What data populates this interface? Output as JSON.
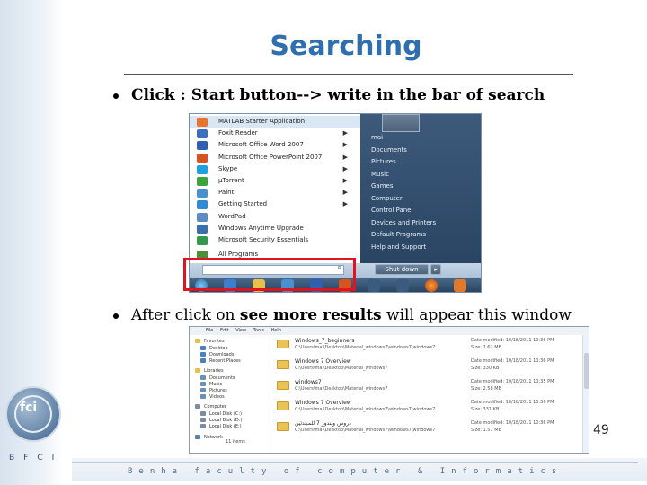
{
  "slide": {
    "title": "Searching",
    "bullet1": "Click : Start button--> write in the bar of search",
    "bullet2_before": "After click on ",
    "bullet2_bold": "see more results",
    "bullet2_after": " will appear this window",
    "page_number": "49",
    "footer": "Benha faculty of computer & Informatics",
    "logo_text": "BFCI",
    "logo_mark": "fci"
  },
  "start_menu": {
    "items": [
      {
        "label": "MATLAB Starter Application",
        "color": "#e8752a",
        "arrow": false
      },
      {
        "label": "Foxit Reader",
        "color": "#3b6fc0",
        "arrow": true
      },
      {
        "label": "Microsoft Office Word 2007",
        "color": "#2f5fb3",
        "arrow": true
      },
      {
        "label": "Microsoft Office PowerPoint 2007",
        "color": "#d9531e",
        "arrow": true
      },
      {
        "label": "Skype",
        "color": "#1aa3e0",
        "arrow": true
      },
      {
        "label": "µTorrent",
        "color": "#3aa53a",
        "arrow": true
      },
      {
        "label": "Paint",
        "color": "#4a8fd0",
        "arrow": true
      },
      {
        "label": "Getting Started",
        "color": "#2e8bd6",
        "arrow": true
      },
      {
        "label": "WordPad",
        "color": "#5b8dc4",
        "arrow": false
      },
      {
        "label": "Windows Anytime Upgrade",
        "color": "#3a6fb0",
        "arrow": false
      },
      {
        "label": "Microsoft Security Essentials",
        "color": "#2e9a4a",
        "arrow": false
      },
      {
        "label": "All Programs",
        "color": "#4b8f3a",
        "arrow": false
      }
    ],
    "right_items": [
      "mai",
      "Documents",
      "Pictures",
      "Music",
      "Games",
      "Computer",
      "Control Panel",
      "Devices and Printers",
      "Default Programs",
      "Help and Support"
    ],
    "shutdown_label": "Shut down",
    "shutdown_arrow": "▸",
    "search_icon": "magnifier-icon"
  },
  "explorer": {
    "menu": "File Edit View Tools Help",
    "sidebar": [
      {
        "label": "Favorites",
        "color": "#e8c14a"
      },
      {
        "label": "Desktop",
        "color": "#4a7fc0"
      },
      {
        "label": "Downloads",
        "color": "#4a7fc0"
      },
      {
        "label": "Recent Places",
        "color": "#4a7fc0"
      },
      {
        "label": "Libraries",
        "color": "#e8c14a"
      },
      {
        "label": "Documents",
        "color": "#6a8fb8"
      },
      {
        "label": "Music",
        "color": "#6a8fb8"
      },
      {
        "label": "Pictures",
        "color": "#6a8fb8"
      },
      {
        "label": "Videos",
        "color": "#6a8fb8"
      },
      {
        "label": "Computer",
        "color": "#7b8da3"
      },
      {
        "label": "Local Disk (C:)",
        "color": "#7b8da3"
      },
      {
        "label": "Local Disk (D:)",
        "color": "#7b8da3"
      },
      {
        "label": "Local Disk (E:)",
        "color": "#7b8da3"
      },
      {
        "label": "Network",
        "color": "#5b7fa8"
      }
    ],
    "rows": [
      {
        "name": "Windows_7_beginners",
        "path": "C:\\Users\\mai\\Desktop\\Material_windows7\\windows7\\windows7",
        "date": "Date modified: 10/18/2011 10:36 PM",
        "size": "Size: 2.62 MB"
      },
      {
        "name": "Windows 7 Overview",
        "path": "C:\\Users\\mai\\Desktop\\Material_windows7",
        "date": "Date modified: 10/18/2011 10:36 PM",
        "size": "Size: 330 KB"
      },
      {
        "name": "windows7",
        "path": "C:\\Users\\mai\\Desktop\\Material_windows7",
        "date": "Date modified: 10/18/2011 10:35 PM",
        "size": "Size: 2.58 MB"
      },
      {
        "name": "Windows 7 Overview",
        "path": "C:\\Users\\mai\\Desktop\\Material_windows7\\windows7\\windows7",
        "date": "Date modified: 10/18/2011 10:36 PM",
        "size": "Size: 331 KB"
      },
      {
        "name": "دروس ويندوز 7 للمبتدئين",
        "path": "C:\\Users\\mai\\Desktop\\Material_windows7\\windows7\\windows7",
        "date": "Date modified: 10/18/2011 10:36 PM",
        "size": "Size: 1.57 MB"
      }
    ],
    "status": "11 items"
  }
}
